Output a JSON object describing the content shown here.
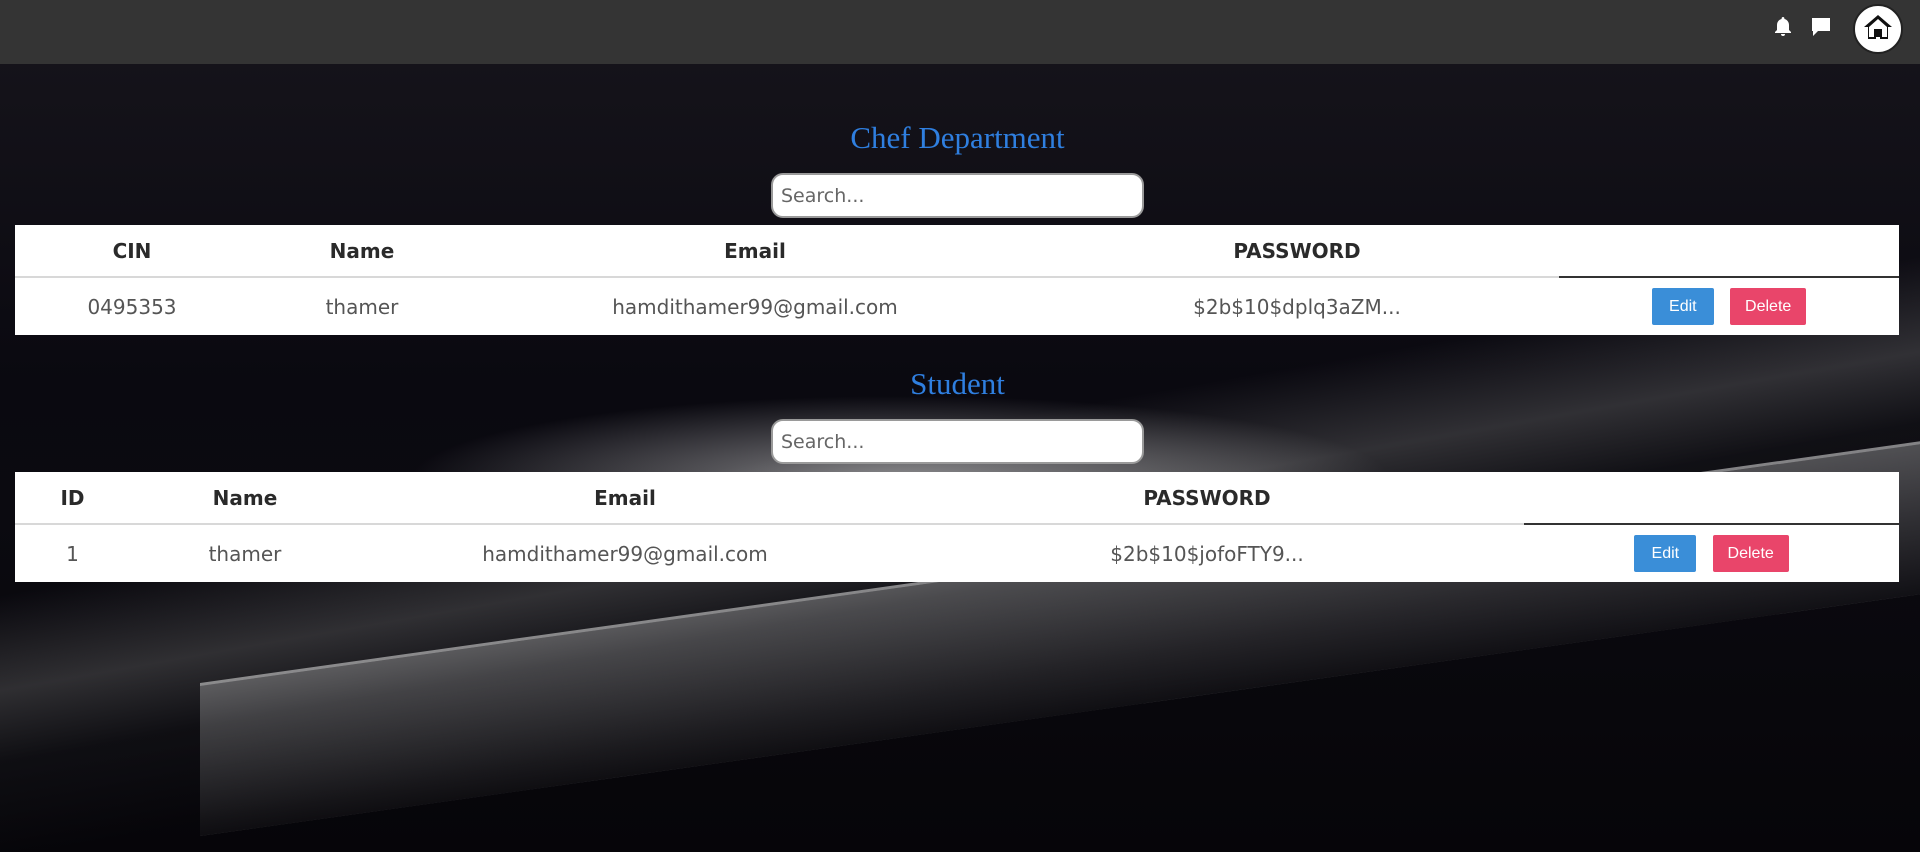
{
  "icons": {
    "bell": "bell-icon",
    "chat": "chat-icon",
    "home": "home-icon"
  },
  "colors": {
    "topbar": "#343434",
    "title": "#2f7fe0",
    "edit_button": "#3a8ed8",
    "delete_button": "#e9456a"
  },
  "chef": {
    "title": "Chef Department",
    "search_placeholder": "Search...",
    "columns": [
      "CIN",
      "Name",
      "Email",
      "PASSWORD",
      ""
    ],
    "rows": [
      {
        "cin": "0495353",
        "name": "thamer",
        "email": "hamdithamer99@gmail.com",
        "password": "$2b$10$dplq3aZM..."
      }
    ],
    "edit_label": "Edit",
    "delete_label": "Delete"
  },
  "student": {
    "title": "Student",
    "search_placeholder": "Search...",
    "columns": [
      "ID",
      "Name",
      "Email",
      "PASSWORD",
      ""
    ],
    "rows": [
      {
        "id": "1",
        "name": "thamer",
        "email": "hamdithamer99@gmail.com",
        "password": "$2b$10$jofoFTY9..."
      }
    ],
    "edit_label": "Edit",
    "delete_label": "Delete"
  }
}
